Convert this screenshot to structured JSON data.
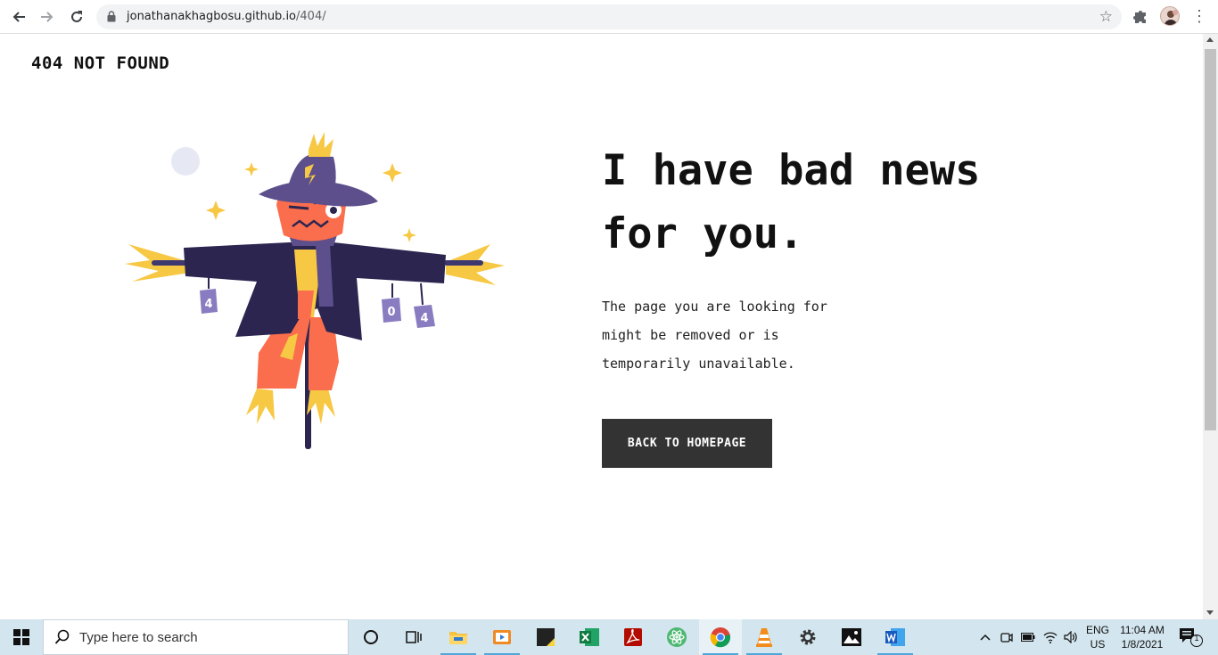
{
  "browser": {
    "url_host": "jonathanakhagbosu.github.io",
    "url_path": "/404/"
  },
  "page": {
    "brand": "404 NOT FOUND",
    "headline_line1": "I have bad news",
    "headline_line2": "for you.",
    "description_line1": "The page you are looking for",
    "description_line2": "might be removed or is",
    "description_line3": "temporarily unavailable.",
    "cta_label": "BACK TO HOMEPAGE",
    "illustration_labels": [
      "4",
      "0",
      "4"
    ]
  },
  "taskbar": {
    "search_placeholder": "Type here to search",
    "apps": [
      "cortana-circle",
      "task-view",
      "file-explorer",
      "media-player",
      "sticky-notes",
      "excel",
      "acrobat-reader",
      "atom",
      "chrome",
      "vlc",
      "settings",
      "photos",
      "word"
    ],
    "language_line1": "ENG",
    "language_line2": "US",
    "time": "11:04 AM",
    "date": "1/8/2021",
    "notification_count": "1"
  },
  "colors": {
    "cta_background": "#333333",
    "scarecrow_coat": "#2b2550",
    "scarecrow_hat": "#5c4f8c",
    "scarecrow_orange": "#fb6e4d",
    "scarecrow_straw": "#f7c844",
    "taskbar": "#d3e5ee"
  }
}
